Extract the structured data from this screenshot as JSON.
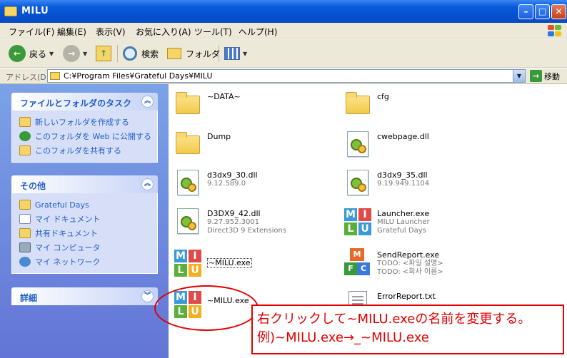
{
  "window": {
    "title": "MILU"
  },
  "menu": {
    "items": [
      "ファイル(F)",
      "編集(E)",
      "表示(V)",
      "お気に入り(A)",
      "ツール(T)",
      "ヘルプ(H)"
    ]
  },
  "toolbar": {
    "back_label": "戻る",
    "search_label": "検索",
    "folders_label": "フォルダ"
  },
  "address": {
    "label": "アドレス(D)",
    "path": "C:¥Program Files¥Grateful Days¥MILU",
    "go_label": "移動"
  },
  "tasks": {
    "title": "ファイルとフォルダのタスク",
    "items": [
      "新しいフォルダを作成する",
      "このフォルダを Web に公開する",
      "このフォルダを共有する"
    ]
  },
  "other": {
    "title": "その他",
    "items": [
      "Grateful Days",
      "マイ ドキュメント",
      "共有ドキュメント",
      "マイ コンピュータ",
      "マイ ネットワーク"
    ]
  },
  "details": {
    "title": "詳細"
  },
  "files": [
    {
      "name": "~DATA~",
      "type": "folder"
    },
    {
      "name": "cfg",
      "type": "folder"
    },
    {
      "name": "Dump",
      "type": "folder"
    },
    {
      "name": "cwebpage.dll",
      "type": "dll"
    },
    {
      "name": "d3dx9_30.dll",
      "sub1": "9.12.589.0",
      "type": "dll"
    },
    {
      "name": "d3dx9_35.dll",
      "sub1": "9.19.949.1104",
      "type": "dll"
    },
    {
      "name": "D3DX9_42.dll",
      "sub1": "9.27.952.3001",
      "sub2": "Direct3D 9 Extensions",
      "type": "dll"
    },
    {
      "name": "Launcher.exe",
      "sub1": "MILU Launcher",
      "sub2": "Grateful Days",
      "type": "milu"
    },
    {
      "name": "~MILU.exe",
      "type": "milu"
    },
    {
      "name": "SendReport.exe",
      "sub1": "TODO: <파일 설명>",
      "sub2": "TODO: <회사 이름>",
      "type": "mfc"
    },
    {
      "name": "~MILU.exe",
      "type": "milu"
    },
    {
      "name": "ErrorReport.txt",
      "type": "txt"
    }
  ],
  "annotation": {
    "line1": "右クリックして~MILU.exeの名前を変更する。",
    "line2": "例)~MILU.exe→_~MILU.exe"
  },
  "colors": {
    "accent": "#e00000",
    "link": "#215dc6",
    "pane": "#6375d6"
  }
}
